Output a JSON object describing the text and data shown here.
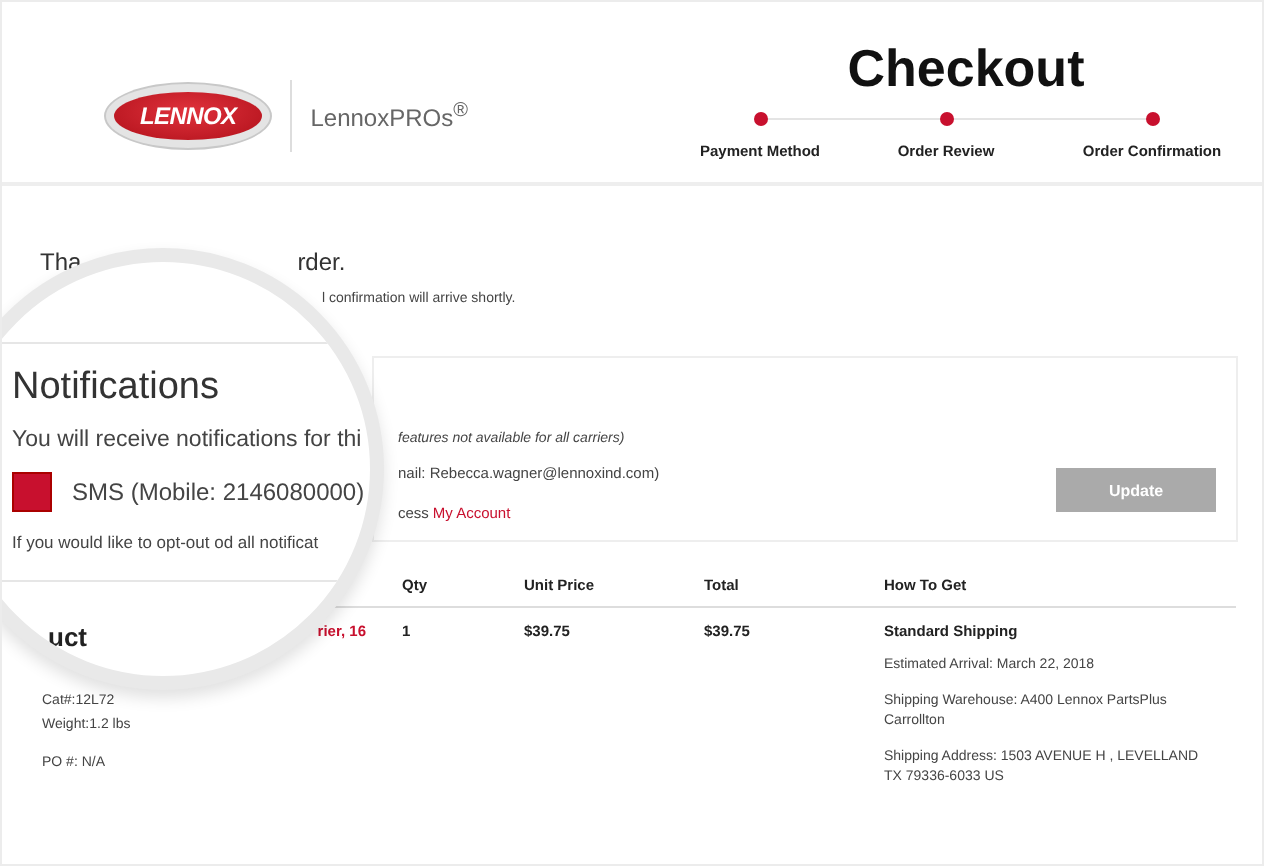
{
  "header": {
    "logo": "LENNOX",
    "brand": "LennoxPROs$^{®}$",
    "title": "Checkout",
    "steps": [
      {
        "label": "Payment Method"
      },
      {
        "label": "Order Review"
      },
      {
        "label": "Order Confirmation"
      }
    ]
  },
  "confirmation": {
    "heading_start": "Tha",
    "heading_end": "rder.",
    "note": "l confirmation will arrive shortly."
  },
  "notifications_panel": {
    "carrier_note": "features not available for all carriers)",
    "email": "nail: Rebecca.wagner@lennoxind.com)",
    "account_prefix": "cess",
    "account_link": "My Account",
    "update_button": {
      "label": "Update",
      "disabled": true
    }
  },
  "table": {
    "columns": [
      "Qty",
      "Unit Price",
      "Total",
      "How To Get"
    ],
    "rows": [
      {
        "product_name": "rier, 16",
        "catalog": "Cat#:12L72",
        "weight": "Weight:1.2 lbs",
        "po": "PO #: N/A",
        "qty": "1",
        "unit_price": "$39.75",
        "total": "$39.75",
        "shipping": {
          "method": "Standard Shipping",
          "lines": [
            "Estimated Arrival: March 22, 2018",
            "Shipping Warehouse: A400 Lennox PartsPlus Carrollton",
            "Shipping Address: 1503 AVENUE H , LEVELLAND TX 79336-6033 US"
          ]
        }
      }
    ]
  },
  "magnifier": {
    "title": "Notifications",
    "intro": "You will receive notifications for thi",
    "option": {
      "label": "SMS (Mobile: 2146080000)",
      "checked": true
    },
    "opt_out": "If you would like to opt-out od all notificat",
    "product_fragment": "uct"
  }
}
